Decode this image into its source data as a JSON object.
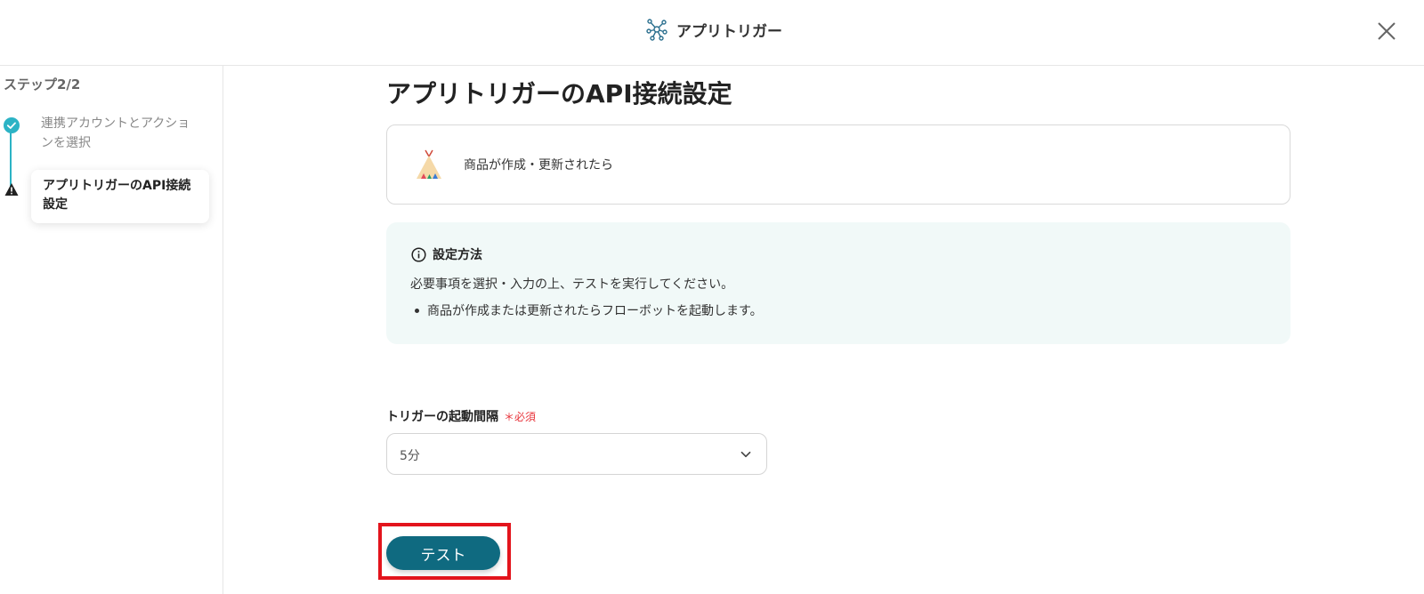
{
  "header": {
    "title": "アプリトリガー",
    "app_icon": "network-nodes-icon",
    "close_icon": "close-icon"
  },
  "sidebar": {
    "step_count": "ステップ2/2",
    "steps": [
      {
        "label": "連携アカウントとアクションを選択",
        "status": "completed",
        "icon": "check-circle-icon"
      },
      {
        "label": "アプリトリガーのAPI接続設定",
        "status": "warning",
        "icon": "warning-icon"
      }
    ]
  },
  "main": {
    "title": "アプリトリガーのAPI接続設定",
    "trigger_card": {
      "label": "商品が作成・更新されたら",
      "icon": "tent-icon"
    },
    "info": {
      "title": "設定方法",
      "text": "必要事項を選択・入力の上、テストを実行してください。",
      "bullets": [
        "商品が作成または更新されたらフローボットを起動します。"
      ]
    },
    "interval_field": {
      "label": "トリガーの起動間隔",
      "required_mark": "＊",
      "required_text": "必須",
      "value": "5分"
    },
    "test_button": "テスト"
  },
  "colors": {
    "accent": "#0f6a80",
    "timeline": "#2cb3c5",
    "info_bg": "#f1f9f8",
    "required": "#e8333a",
    "highlight": "#e3141c"
  }
}
